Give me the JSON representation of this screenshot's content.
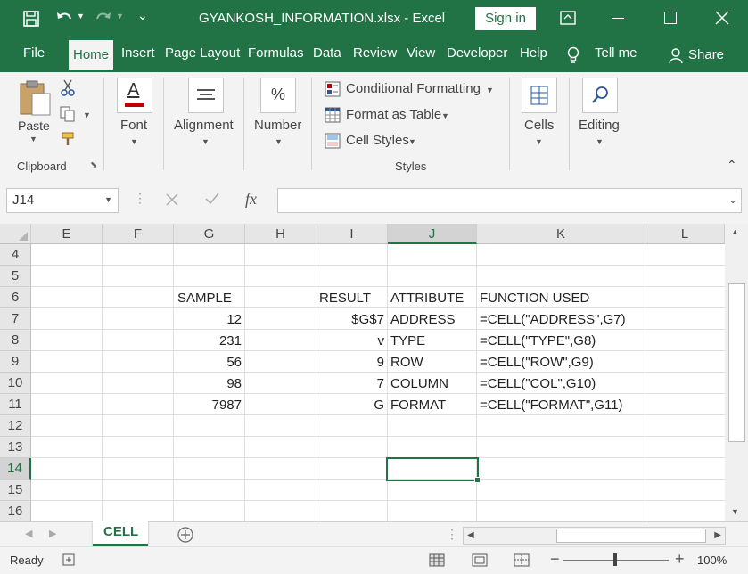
{
  "window": {
    "title": "GYANKOSH_INFORMATION.xlsx  -  Excel",
    "sign_in": "Sign in"
  },
  "ribbon_tabs": [
    "File",
    "Home",
    "Insert",
    "Page Layout",
    "Formulas",
    "Data",
    "Review",
    "View",
    "Developer",
    "Help",
    "Tell me",
    "Share"
  ],
  "ribbon": {
    "paste": "Paste",
    "clipboard": "Clipboard",
    "font": "Font",
    "alignment": "Alignment",
    "number": "Number",
    "number_glyph": "%",
    "font_glyph": "A",
    "conditional_formatting": "Conditional Formatting",
    "format_as_table": "Format as Table",
    "cell_styles": "Cell Styles",
    "styles": "Styles",
    "cells": "Cells",
    "editing": "Editing"
  },
  "formula_bar": {
    "name_box": "J14",
    "fx": "fx",
    "formula": ""
  },
  "columns": [
    "E",
    "F",
    "G",
    "H",
    "I",
    "J",
    "K",
    "L"
  ],
  "selected_column": "J",
  "rows": [
    "4",
    "5",
    "6",
    "7",
    "8",
    "9",
    "10",
    "11",
    "12",
    "13",
    "14",
    "15",
    "16"
  ],
  "selected_row": "14",
  "table": {
    "headers": {
      "sample": "SAMPLE",
      "result": "RESULT",
      "attribute": "ATTRIBUTE",
      "function": "FUNCTION USED"
    },
    "data": [
      {
        "sample": "12",
        "result": "$G$7",
        "attribute": "ADDRESS",
        "function": "=CELL(\"ADDRESS\",G7)"
      },
      {
        "sample": "231",
        "result": "v",
        "attribute": "TYPE",
        "function": "=CELL(\"TYPE\",G8)"
      },
      {
        "sample": "56",
        "result": "9",
        "attribute": "ROW",
        "function": "=CELL(\"ROW\",G9)"
      },
      {
        "sample": "98",
        "result": "7",
        "attribute": "COLUMN",
        "function": "=CELL(\"COL\",G10)"
      },
      {
        "sample": "7987",
        "result": "G",
        "attribute": "FORMAT",
        "function": "=CELL(\"FORMAT\",G11)"
      }
    ]
  },
  "sheet_tabs": [
    "CELL"
  ],
  "status": {
    "ready": "Ready",
    "zoom": "100%"
  }
}
